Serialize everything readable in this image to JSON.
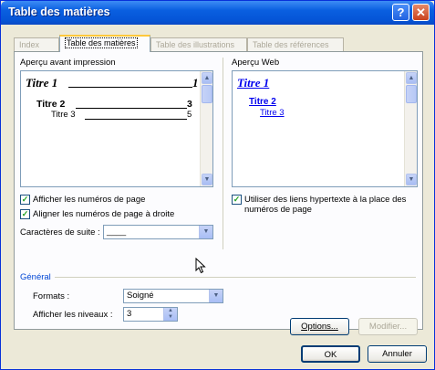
{
  "window": {
    "title": "Table des matières",
    "help_glyph": "?",
    "close_glyph": "✕"
  },
  "tabs": [
    {
      "label": "Index",
      "active": false
    },
    {
      "label": "Table des matières",
      "active": true
    },
    {
      "label": "Table des illustrations",
      "active": false
    },
    {
      "label": "Table des références",
      "active": false
    }
  ],
  "print_preview": {
    "label": "Aperçu avant impression",
    "entries": [
      {
        "text": "Titre 1",
        "page": "1"
      },
      {
        "text": "Titre 2",
        "page": "3"
      },
      {
        "text": "Titre 3",
        "page": "5"
      }
    ]
  },
  "web_preview": {
    "label": "Aperçu Web",
    "entries": [
      "Titre 1",
      "Titre 2",
      "Titre 3"
    ]
  },
  "options": {
    "show_page_numbers": {
      "label": "Afficher les numéros de page",
      "checked": true
    },
    "align_page_numbers": {
      "label": "Aligner les numéros de page à droite",
      "checked": true
    },
    "use_hyperlinks": {
      "label_line1": "Utiliser des liens hypertexte à la place des",
      "label_line2": "numéros de page",
      "checked": true
    },
    "tab_leader": {
      "label": "Caractères de suite :",
      "value": "____"
    }
  },
  "general": {
    "label": "Général",
    "formats": {
      "label": "Formats :",
      "value": "Soigné"
    },
    "levels": {
      "label": "Afficher les niveaux :",
      "value": "3"
    }
  },
  "buttons": {
    "options": "Options...",
    "modify": "Modifier...",
    "ok": "OK",
    "cancel": "Annuler"
  },
  "colors": {
    "title_bar": "#0a5fe0",
    "link": "#0000ee",
    "group_label": "#0046d5"
  }
}
